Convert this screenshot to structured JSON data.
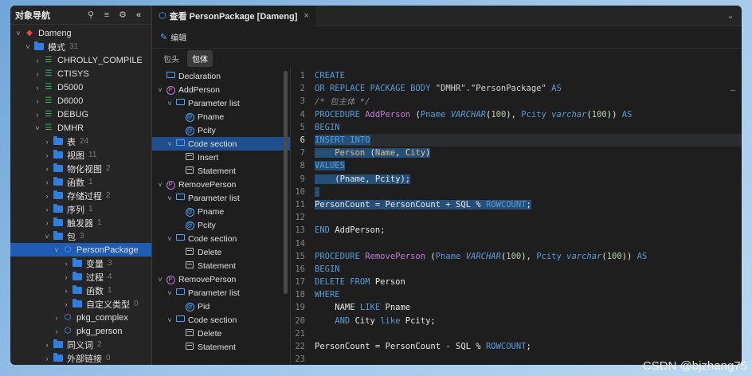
{
  "nav": {
    "title": "对象导航",
    "tree": [
      {
        "label": "Dameng",
        "indent": 0,
        "chev": "v",
        "icon": "db",
        "count": ""
      },
      {
        "label": "模式",
        "indent": 1,
        "chev": "v",
        "icon": "folder",
        "count": "31"
      },
      {
        "label": "CHROLLY_COMPILE",
        "indent": 2,
        "chev": ">",
        "icon": "schema",
        "count": ""
      },
      {
        "label": "CTISYS",
        "indent": 2,
        "chev": ">",
        "icon": "schema",
        "count": ""
      },
      {
        "label": "D5000",
        "indent": 2,
        "chev": ">",
        "icon": "schema",
        "count": ""
      },
      {
        "label": "D6000",
        "indent": 2,
        "chev": ">",
        "icon": "schema",
        "count": ""
      },
      {
        "label": "DEBUG",
        "indent": 2,
        "chev": ">",
        "icon": "schema",
        "count": ""
      },
      {
        "label": "DMHR",
        "indent": 2,
        "chev": "v",
        "icon": "schema",
        "count": ""
      },
      {
        "label": "表",
        "indent": 3,
        "chev": ">",
        "icon": "folder",
        "count": "24"
      },
      {
        "label": "视图",
        "indent": 3,
        "chev": ">",
        "icon": "folder",
        "count": "11"
      },
      {
        "label": "物化视图",
        "indent": 3,
        "chev": ">",
        "icon": "folder",
        "count": "2"
      },
      {
        "label": "函数",
        "indent": 3,
        "chev": ">",
        "icon": "folder",
        "count": "1"
      },
      {
        "label": "存储过程",
        "indent": 3,
        "chev": ">",
        "icon": "folder",
        "count": "2"
      },
      {
        "label": "序列",
        "indent": 3,
        "chev": ">",
        "icon": "folder",
        "count": "1"
      },
      {
        "label": "触发器",
        "indent": 3,
        "chev": ">",
        "icon": "folder",
        "count": "1"
      },
      {
        "label": "包",
        "indent": 3,
        "chev": "v",
        "icon": "folder",
        "count": "3"
      },
      {
        "label": "PersonPackage",
        "indent": 4,
        "chev": "v",
        "icon": "pkg",
        "count": "",
        "selected": true
      },
      {
        "label": "变量",
        "indent": 5,
        "chev": ">",
        "icon": "folder",
        "count": "3"
      },
      {
        "label": "过程",
        "indent": 5,
        "chev": ">",
        "icon": "folder",
        "count": "4"
      },
      {
        "label": "函数",
        "indent": 5,
        "chev": ">",
        "icon": "folder",
        "count": "1"
      },
      {
        "label": "自定义类型",
        "indent": 5,
        "chev": ">",
        "icon": "folder",
        "count": "0"
      },
      {
        "label": "pkg_complex",
        "indent": 4,
        "chev": ">",
        "icon": "pkg",
        "count": ""
      },
      {
        "label": "pkg_person",
        "indent": 4,
        "chev": ">",
        "icon": "pkg",
        "count": ""
      },
      {
        "label": "同义词",
        "indent": 3,
        "chev": ">",
        "icon": "folder",
        "count": "2"
      },
      {
        "label": "外部链接",
        "indent": 3,
        "chev": ">",
        "icon": "folder",
        "count": "0"
      }
    ]
  },
  "tab": {
    "label": "查看 PersonPackage [Dameng]",
    "close": "×"
  },
  "toolbar": {
    "edit": "编辑"
  },
  "subtabs": [
    {
      "label": "包头",
      "active": false
    },
    {
      "label": "包体",
      "active": true
    }
  ],
  "outline": [
    {
      "label": "Declaration",
      "indent": 0,
      "chev": "",
      "icon": "folder"
    },
    {
      "label": "AddPerson",
      "indent": 0,
      "chev": "v",
      "icon": "p"
    },
    {
      "label": "Parameter list",
      "indent": 1,
      "chev": "v",
      "icon": "folder"
    },
    {
      "label": "Pname",
      "indent": 2,
      "chev": "",
      "icon": "at"
    },
    {
      "label": "Pcity",
      "indent": 2,
      "chev": "",
      "icon": "at"
    },
    {
      "label": "Code section",
      "indent": 1,
      "chev": "v",
      "icon": "folder",
      "selected": true
    },
    {
      "label": "Insert",
      "indent": 2,
      "chev": "",
      "icon": "stmt"
    },
    {
      "label": "Statement",
      "indent": 2,
      "chev": "",
      "icon": "stmt"
    },
    {
      "label": "RemovePerson",
      "indent": 0,
      "chev": "v",
      "icon": "p"
    },
    {
      "label": "Parameter list",
      "indent": 1,
      "chev": "v",
      "icon": "folder"
    },
    {
      "label": "Pname",
      "indent": 2,
      "chev": "",
      "icon": "at"
    },
    {
      "label": "Pcity",
      "indent": 2,
      "chev": "",
      "icon": "at"
    },
    {
      "label": "Code section",
      "indent": 1,
      "chev": "v",
      "icon": "folder"
    },
    {
      "label": "Delete",
      "indent": 2,
      "chev": "",
      "icon": "stmt"
    },
    {
      "label": "Statement",
      "indent": 2,
      "chev": "",
      "icon": "stmt"
    },
    {
      "label": "RemovePerson",
      "indent": 0,
      "chev": "v",
      "icon": "p"
    },
    {
      "label": "Parameter list",
      "indent": 1,
      "chev": "v",
      "icon": "folder"
    },
    {
      "label": "Pid",
      "indent": 2,
      "chev": "",
      "icon": "at"
    },
    {
      "label": "Code section",
      "indent": 1,
      "chev": "v",
      "icon": "folder"
    },
    {
      "label": "Delete",
      "indent": 2,
      "chev": "",
      "icon": "stmt"
    },
    {
      "label": "Statement",
      "indent": 2,
      "chev": "",
      "icon": "stmt"
    }
  ],
  "code": [
    {
      "n": "1",
      "t": [
        [
          "kw",
          "CREATE"
        ]
      ]
    },
    {
      "n": "2",
      "t": [
        [
          "kw",
          "OR REPLACE PACKAGE BODY "
        ],
        [
          "str",
          "\"DMHR\".\"PersonPackage\" "
        ],
        [
          "kw",
          "AS"
        ]
      ]
    },
    {
      "n": "3",
      "t": [
        [
          "cm",
          "/* 包主体 */"
        ]
      ]
    },
    {
      "n": "4",
      "t": [
        [
          "kw",
          "PROCEDURE "
        ],
        [
          "fn",
          "AddPerson"
        ],
        [
          "id",
          " ("
        ],
        [
          "kw",
          "Pname "
        ],
        [
          "typ",
          "VARCHAR"
        ],
        [
          "id",
          "("
        ],
        [
          "num",
          "100"
        ],
        [
          "id",
          "), "
        ],
        [
          "kw",
          "Pcity "
        ],
        [
          "typ",
          "varchar"
        ],
        [
          "id",
          "("
        ],
        [
          "num",
          "100"
        ],
        [
          "id",
          ")) "
        ],
        [
          "kw",
          "AS"
        ]
      ]
    },
    {
      "n": "5",
      "t": [
        [
          "kw",
          "BEGIN"
        ]
      ]
    },
    {
      "n": "6",
      "cur": true,
      "t": [
        [
          "kw hl",
          "INSERT INTO"
        ]
      ]
    },
    {
      "n": "7",
      "t": [
        [
          "id hl",
          "    "
        ],
        [
          "idv hl",
          "Person"
        ],
        [
          "id hl",
          " ("
        ],
        [
          "idv hl",
          "Name"
        ],
        [
          "id hl",
          ", "
        ],
        [
          "idv hl",
          "City"
        ],
        [
          "id hl",
          ")"
        ]
      ]
    },
    {
      "n": "8",
      "t": [
        [
          "kw hl",
          "VALUES"
        ]
      ]
    },
    {
      "n": "9",
      "t": [
        [
          "id hl",
          "    (Pname, Pcity);"
        ]
      ]
    },
    {
      "n": "10",
      "t": [
        [
          "id hl",
          " "
        ]
      ]
    },
    {
      "n": "11",
      "t": [
        [
          "id hl",
          "PersonCount = PersonCount + SQL % "
        ],
        [
          "kw hl",
          "ROWCOUNT"
        ],
        [
          "id hl",
          ";"
        ]
      ]
    },
    {
      "n": "12",
      "t": [
        [
          "id",
          ""
        ]
      ]
    },
    {
      "n": "13",
      "t": [
        [
          "kw",
          "END "
        ],
        [
          "id",
          "AddPerson;"
        ]
      ]
    },
    {
      "n": "14",
      "t": [
        [
          "id",
          ""
        ]
      ]
    },
    {
      "n": "15",
      "t": [
        [
          "kw",
          "PROCEDURE "
        ],
        [
          "fn",
          "RemovePerson"
        ],
        [
          "id",
          " ("
        ],
        [
          "kw",
          "Pname "
        ],
        [
          "typ",
          "VARCHAR"
        ],
        [
          "id",
          "("
        ],
        [
          "num",
          "100"
        ],
        [
          "id",
          "), "
        ],
        [
          "kw",
          "Pcity "
        ],
        [
          "typ",
          "varchar"
        ],
        [
          "id",
          "("
        ],
        [
          "num",
          "100"
        ],
        [
          "id",
          ")) "
        ],
        [
          "kw",
          "AS"
        ]
      ]
    },
    {
      "n": "16",
      "t": [
        [
          "kw",
          "BEGIN"
        ]
      ]
    },
    {
      "n": "17",
      "t": [
        [
          "kw",
          "DELETE FROM "
        ],
        [
          "id",
          "Person"
        ]
      ]
    },
    {
      "n": "18",
      "t": [
        [
          "kw",
          "WHERE"
        ]
      ]
    },
    {
      "n": "19",
      "t": [
        [
          "id",
          "    NAME "
        ],
        [
          "kw",
          "LIKE "
        ],
        [
          "id",
          "Pname"
        ]
      ]
    },
    {
      "n": "20",
      "t": [
        [
          "kw",
          "    AND "
        ],
        [
          "id",
          "City "
        ],
        [
          "kw",
          "like "
        ],
        [
          "id",
          "Pcity;"
        ]
      ]
    },
    {
      "n": "21",
      "t": [
        [
          "id",
          ""
        ]
      ]
    },
    {
      "n": "22",
      "t": [
        [
          "id",
          "PersonCount = PersonCount - SQL % "
        ],
        [
          "kw",
          "ROWCOUNT"
        ],
        [
          "id",
          ";"
        ]
      ]
    },
    {
      "n": "23",
      "t": [
        [
          "id",
          ""
        ]
      ]
    }
  ],
  "watermark": "CSDN @bjzhang75"
}
